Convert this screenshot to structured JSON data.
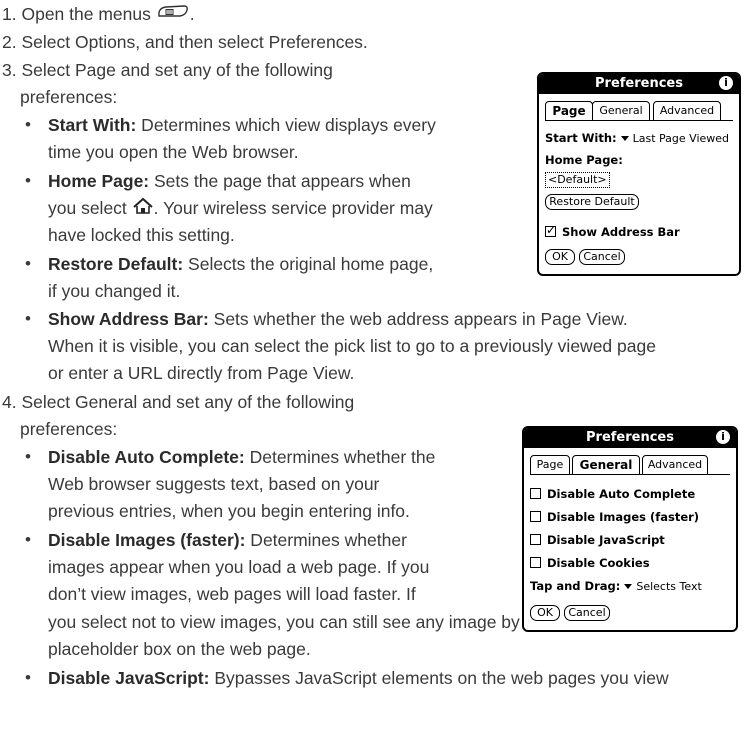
{
  "steps": [
    {
      "num": "1.",
      "text_before": "Open the menus",
      "text_after": "."
    },
    {
      "num": "2.",
      "text": "Select Options, and then select Preferences."
    },
    {
      "num": "3.",
      "line1": "Select Page and set any of the following",
      "line2": "preferences:"
    },
    {
      "num": "4.",
      "line1": "Select General and set any of the following",
      "line2": "preferences:"
    }
  ],
  "page_bullets": {
    "start_with": {
      "term": "Start With:",
      "line1": " Determines which view displays every",
      "line2": "time you open the Web browser."
    },
    "home_page": {
      "term": "Home Page:",
      "line1": " Sets the page that appears when",
      "line2_before": "you select",
      "line2_after": ". Your wireless service provider may",
      "line3": "have locked this setting."
    },
    "restore_default": {
      "term": "Restore Default:",
      "line1": " Selects the original home page,",
      "line2": "if you changed it."
    },
    "show_address_bar": {
      "term": "Show Address Bar:",
      "line1": " Sets whether the web address appears in Page View.",
      "line2": "When it is visible, you can select the pick list to go to a previously viewed page",
      "line3": "or enter a URL directly from Page View."
    }
  },
  "general_bullets": {
    "disable_auto_complete": {
      "term": "Disable Auto Complete:",
      "line1": " Determines whether the",
      "line2": "Web browser suggests text, based on your",
      "line3": "previous entries, when you begin entering info."
    },
    "disable_images": {
      "term": "Disable Images (faster):",
      "line1": " Determines whether",
      "line2": "images appear when you load a web page. If you",
      "line3": "don’t view images, web pages will load faster. If",
      "line4": "you select not to view images, you can still see any image by selecting the",
      "line5": "placeholder box on the web page."
    },
    "disable_javascript": {
      "term": "Disable JavaScript:",
      "line1": " Bypasses JavaScript elements on the web pages you view"
    }
  },
  "dialog_page": {
    "title": "Preferences",
    "tabs": [
      "Page",
      "General",
      "Advanced"
    ],
    "start_with_label": "Start With:",
    "start_with_value": "Last Page Viewed",
    "home_page_label": "Home Page:",
    "home_page_value": "<Default>",
    "restore_button": "Restore Default",
    "show_address_label": "Show Address Bar",
    "ok": "OK",
    "cancel": "Cancel"
  },
  "dialog_general": {
    "title": "Preferences",
    "tabs": [
      "Page",
      "General",
      "Advanced"
    ],
    "options": [
      "Disable Auto Complete",
      "Disable Images (faster)",
      "Disable JavaScript",
      "Disable Cookies"
    ],
    "tap_drag_label": "Tap and Drag:",
    "tap_drag_value": "Selects Text",
    "ok": "OK",
    "cancel": "Cancel"
  }
}
